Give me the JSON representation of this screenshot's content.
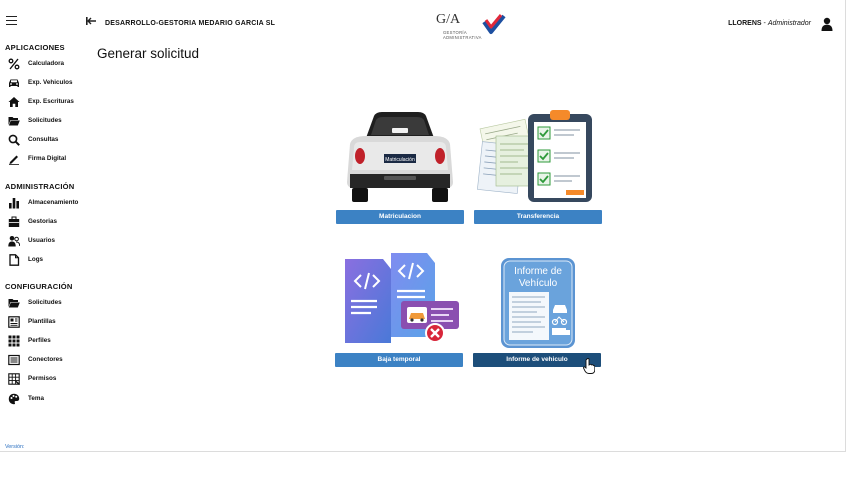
{
  "header": {
    "organization": "DESARROLLO-GESTORIA MEDARIO GARCIA SL",
    "logo_brand": "G/A",
    "logo_line1": "GESTORÍA",
    "logo_line2": "ADMINISTRATIVA",
    "user_name": "LLORENS",
    "user_separator": " - ",
    "user_role": "Administrador"
  },
  "sidebar": {
    "sections": [
      {
        "title": "APLICACIONES",
        "items": [
          {
            "label": "Calculadora",
            "icon": "percent-icon"
          },
          {
            "label": "Exp. Vehiculos",
            "icon": "car-icon"
          },
          {
            "label": "Exp. Escrituras",
            "icon": "home-icon"
          },
          {
            "label": "Solicitudes",
            "icon": "folder-open-icon"
          },
          {
            "label": "Consultas",
            "icon": "search-icon"
          },
          {
            "label": "Firma Digital",
            "icon": "signature-icon"
          }
        ]
      },
      {
        "title": "ADMINISTRACIÓN",
        "items": [
          {
            "label": "Almacenamiento",
            "icon": "bar-chart-icon"
          },
          {
            "label": "Gestorias",
            "icon": "briefcase-icon"
          },
          {
            "label": "Usuarios",
            "icon": "users-icon"
          },
          {
            "label": "Logs",
            "icon": "file-icon"
          }
        ]
      },
      {
        "title": "CONFIGURACIÓN",
        "items": [
          {
            "label": "Solicitudes",
            "icon": "folder-open-icon"
          },
          {
            "label": "Plantillas",
            "icon": "template-icon"
          },
          {
            "label": "Perfiles",
            "icon": "grid-icon"
          },
          {
            "label": "Conectores",
            "icon": "connector-icon"
          },
          {
            "label": "Permisos",
            "icon": "table-icon"
          },
          {
            "label": "Tema",
            "icon": "palette-icon"
          }
        ]
      }
    ],
    "version_label": "Versión:"
  },
  "main": {
    "title": "Generar solicitud",
    "cards": [
      {
        "label": "Matriculacion",
        "art_text": "Matriculación",
        "state": "normal"
      },
      {
        "label": "Transferencia",
        "state": "normal"
      },
      {
        "label": "Baja temporal",
        "state": "normal"
      },
      {
        "label": "Informe de vehiculo",
        "art_text_1": "Informe de",
        "art_text_2": "Vehículo",
        "state": "hover"
      }
    ]
  },
  "colors": {
    "button": "#3c82c4",
    "button_active": "#1d4e7a",
    "logo_red": "#e0283a",
    "logo_blue": "#1d4fa0"
  }
}
